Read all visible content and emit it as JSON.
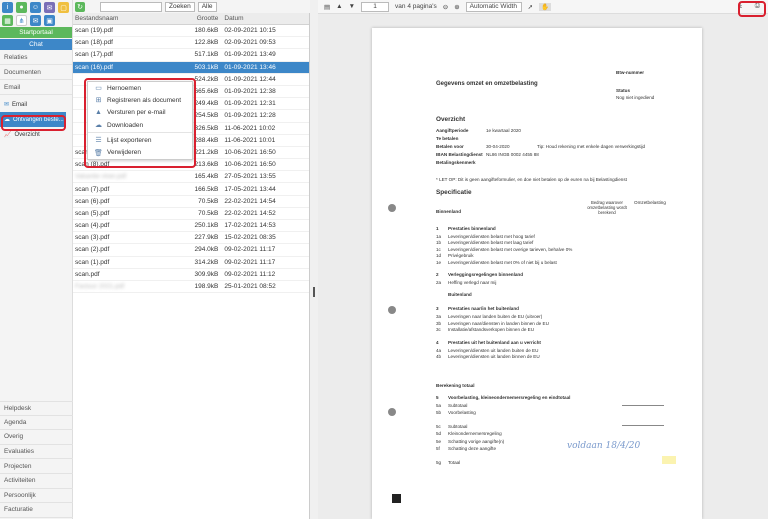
{
  "sidebar": {
    "startportaal": "Startportaal",
    "chat": "Chat",
    "nav": [
      "Relaties",
      "Documenten",
      "Email"
    ],
    "sub_items": [
      {
        "label": "Email",
        "icon": "mail-icon"
      },
      {
        "label": "Ontvangen beste...",
        "icon": "cloud-icon"
      },
      {
        "label": "Overzicht",
        "icon": "chart-icon"
      }
    ],
    "bottom_nav": [
      "Helpdesk",
      "Agenda",
      "Overig",
      "Evaluaties",
      "Projecten",
      "Activiteiten",
      "Persoonlijk",
      "Facturatie"
    ]
  },
  "toolbar": {
    "search_label": "Zoeken",
    "all_label": "Alle"
  },
  "filelist": {
    "headers": [
      "Bestandsnaam",
      "Grootte",
      "Datum"
    ],
    "rows": [
      {
        "name": "scan (19).pdf",
        "size": "180.6kB",
        "date": "02-09-2021 10:15"
      },
      {
        "name": "scan (18).pdf",
        "size": "122.8kB",
        "date": "02-09-2021 09:53"
      },
      {
        "name": "scan (17).pdf",
        "size": "517.1kB",
        "date": "01-09-2021 13:49"
      },
      {
        "name": "scan (16).pdf",
        "size": "503.1kB",
        "date": "01-09-2021 13:46"
      },
      {
        "name": "",
        "size": "524.2kB",
        "date": "01-09-2021 12:44"
      },
      {
        "name": "",
        "size": "665.6kB",
        "date": "01-09-2021 12:38"
      },
      {
        "name": "",
        "size": "249.4kB",
        "date": "01-09-2021 12:31"
      },
      {
        "name": "",
        "size": "254.5kB",
        "date": "01-09-2021 12:28"
      },
      {
        "name": "",
        "size": "326.5kB",
        "date": "11-06-2021 10:02"
      },
      {
        "name": "",
        "size": "288.4kB",
        "date": "11-06-2021 10:01"
      },
      {
        "name": "scan (9).pdf",
        "size": "221.2kB",
        "date": "10-06-2021 16:50"
      },
      {
        "name": "scan (8).pdf",
        "size": "213.6kB",
        "date": "10-06-2021 16:50"
      },
      {
        "name": "Vakantie vloer.pdf",
        "size": "165.4kB",
        "date": "27-05-2021 13:55"
      },
      {
        "name": "scan (7).pdf",
        "size": "166.5kB",
        "date": "17-05-2021 13:44"
      },
      {
        "name": "scan (6).pdf",
        "size": "70.5kB",
        "date": "22-02-2021 14:54"
      },
      {
        "name": "scan (5).pdf",
        "size": "70.5kB",
        "date": "22-02-2021 14:52"
      },
      {
        "name": "scan (4).pdf",
        "size": "250.1kB",
        "date": "17-02-2021 14:53"
      },
      {
        "name": "scan (3).pdf",
        "size": "227.9kB",
        "date": "15-02-2021 08:35"
      },
      {
        "name": "scan (2).pdf",
        "size": "294.0kB",
        "date": "09-02-2021 11:17"
      },
      {
        "name": "scan (1).pdf",
        "size": "314.2kB",
        "date": "09-02-2021 11:17"
      },
      {
        "name": "scan.pdf",
        "size": "309.9kB",
        "date": "09-02-2021 11:12"
      },
      {
        "name": "Factuur 2021.pdf",
        "size": "198.9kB",
        "date": "25-01-2021 08:52"
      }
    ]
  },
  "context_menu": [
    {
      "label": "Hernoemen",
      "icon": "rename-icon"
    },
    {
      "label": "Registreren als document",
      "icon": "register-icon"
    },
    {
      "label": "Versturen per e-mail",
      "icon": "send-mail-icon"
    },
    {
      "label": "Downloaden",
      "icon": "download-icon"
    },
    {
      "label": "Lijst exporteren",
      "icon": "export-list-icon"
    },
    {
      "label": "Verwijderen",
      "icon": "trash-icon"
    }
  ],
  "viewer": {
    "page_number": "1",
    "page_count": "van 4 pagina's",
    "zoom": "Automatic Width"
  },
  "document": {
    "bsn_label": "Btw-nummer",
    "status_label": "Status",
    "status_value": "Nog niet ingediend",
    "title": "Gegevens omzet en omzetbelasting",
    "overview_heading": "Overzicht",
    "overview_rows": [
      {
        "label": "Aangiftperiode",
        "value": "1e kwartaal 2020"
      },
      {
        "label": "Te betalen",
        "value": ""
      },
      {
        "label": "Betalen voor",
        "value": "30-04-2020"
      },
      {
        "label": "IBAN Belastingdienst",
        "value": "NL86 INGB 0002 4455 88"
      },
      {
        "label": "Betalingskenmerk",
        "value": ""
      }
    ],
    "tip": "Tip: Houd rekening met enkele dagen verwerkingstijd",
    "let_op": "* LET OP: Dit is geen aangifteformulier, en doe niet betalen op de euren na bij Belastingdienst",
    "spec_heading": "Specificatie",
    "col_headers": [
      "Bedrag waarover omzetbelasting wordt berekend",
      "Omzetbelasting"
    ],
    "binnenland": "Binnenland",
    "sections": [
      {
        "no": "1",
        "title": "Prestaties binnenland",
        "lines": [
          {
            "code": "1a",
            "text": "Leveringen/diensten belast met hoog tarief"
          },
          {
            "code": "1b",
            "text": "Leveringen/diensten belast met laag tarief"
          },
          {
            "code": "1c",
            "text": "Leveringen/diensten belast met overige tarieven, behalve 0%"
          },
          {
            "code": "1d",
            "text": "Privégebruik"
          },
          {
            "code": "1e",
            "text": "Leveringen/diensten belast met 0% of niet bij u belast"
          }
        ]
      },
      {
        "no": "2",
        "title": "Verleggingsregelingen binnenland",
        "lines": [
          {
            "code": "2a",
            "text": "Heffing verlegd naar mij"
          }
        ]
      },
      {
        "no": "",
        "title": "Buitenland",
        "lines": []
      },
      {
        "no": "3",
        "title": "Prestaties naar/in het buitenland",
        "lines": [
          {
            "code": "3a",
            "text": "Leveringen naar landen buiten de EU (uitvoer)"
          },
          {
            "code": "3b",
            "text": "Leveringen naar/diensten in landen binnen de EU"
          },
          {
            "code": "3c",
            "text": "Installatie/afstandsverkopen binnen de EU"
          }
        ]
      },
      {
        "no": "4",
        "title": "Prestaties uit het buitenland aan u verricht",
        "lines": [
          {
            "code": "4a",
            "text": "Leveringen/diensten uit landen buiten de EU"
          },
          {
            "code": "4b",
            "text": "Leveringen/diensten uit landen binnen de EU"
          }
        ]
      }
    ],
    "total_heading": "Berekening totaal",
    "totals": [
      {
        "code": "5",
        "text": "Voorbelasting, kleineondernemersregeling en eindtotaal"
      },
      {
        "code": "5a",
        "text": "Subtotaal"
      },
      {
        "code": "5b",
        "text": "Voorbelasting"
      },
      {
        "code": "5c",
        "text": "Subtotaal"
      },
      {
        "code": "5d",
        "text": "Kleinondernemersregeling"
      },
      {
        "code": "5e",
        "text": "Schatting vorige aangifte(n)"
      },
      {
        "code": "5f",
        "text": "Schatting deze aangifte"
      },
      {
        "code": "5g",
        "text": "Totaal"
      }
    ],
    "handwriting": "voldaan 18/4/20"
  },
  "colors": {
    "accent": "#3d87c8",
    "green": "#5cb85c",
    "highlight_red": "#d9202f"
  }
}
